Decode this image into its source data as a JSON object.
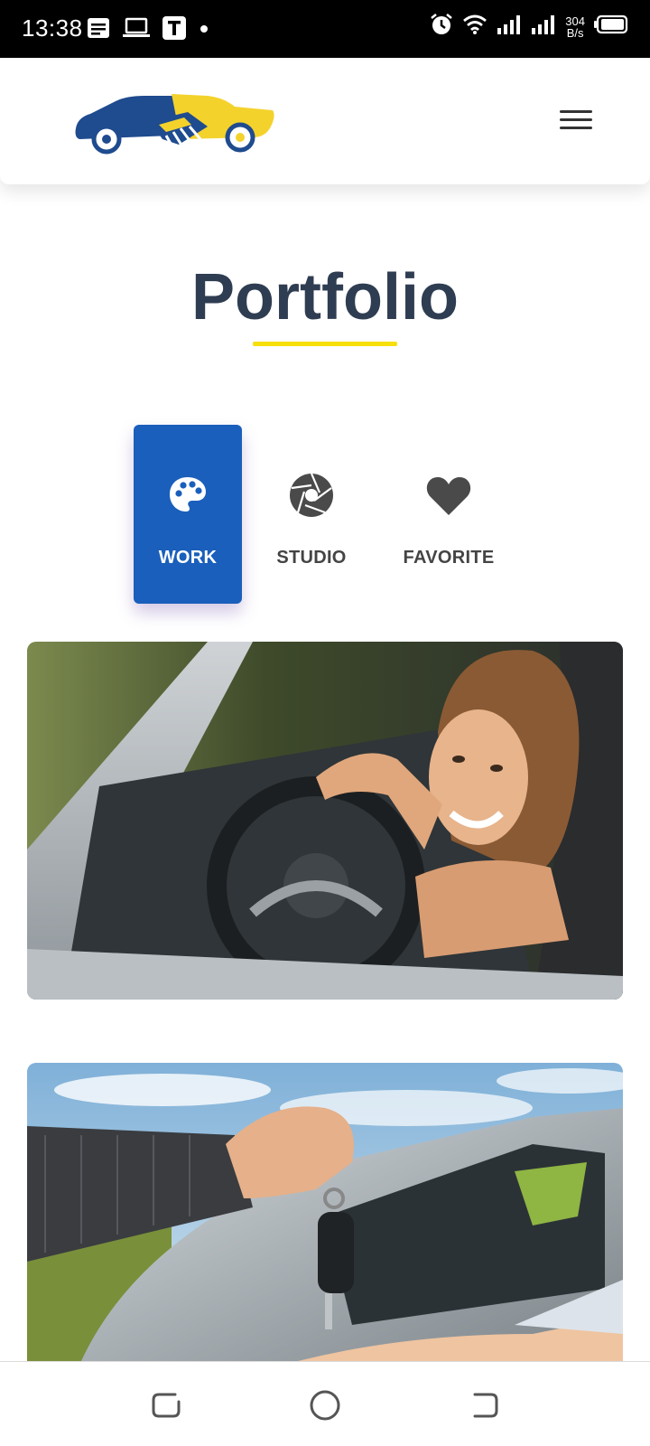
{
  "status_bar": {
    "time": "13:38",
    "net_speed_value": "304",
    "net_speed_unit": "B/s",
    "left_icons": [
      "notes-icon",
      "laptop-icon",
      "t-app-icon",
      "dot-icon"
    ],
    "right_icons": [
      "alarm-icon",
      "wifi-icon",
      "signal-icon",
      "signal-icon",
      "battery-icon"
    ]
  },
  "header": {
    "logo_name": "car-handshake-logo",
    "menu_icon": "hamburger-menu-icon"
  },
  "page": {
    "title": "Portfolio",
    "accent_color": "#f6df0b",
    "title_color": "#2f3d52"
  },
  "tabs": [
    {
      "label": "WORK",
      "icon": "palette-icon",
      "active": true
    },
    {
      "label": "STUDIO",
      "icon": "camera-aperture-icon",
      "active": false
    },
    {
      "label": "FAVORITE",
      "icon": "heart-icon",
      "active": false
    }
  ],
  "tab_active_color": "#1a5fbb",
  "photos": [
    {
      "name": "woman-in-convertible-photo"
    },
    {
      "name": "car-key-handover-photo"
    }
  ],
  "nav_bar": {
    "buttons": [
      "back-icon",
      "home-icon",
      "recents-icon"
    ]
  }
}
